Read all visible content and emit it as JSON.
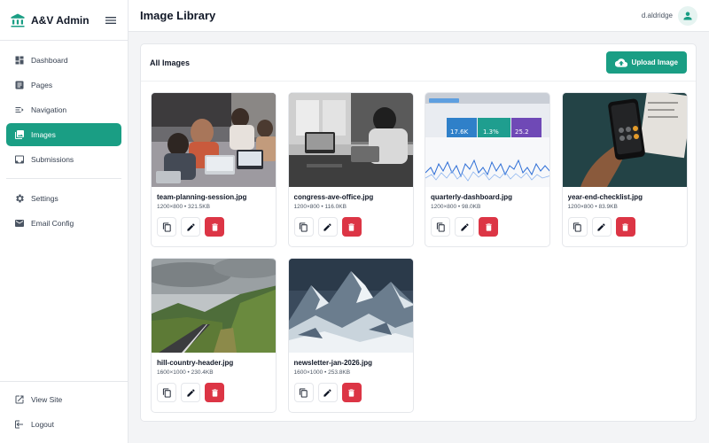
{
  "brand": {
    "name": "A&V Admin"
  },
  "sidebar": {
    "items": [
      {
        "label": "Dashboard",
        "icon": "dashboard-icon"
      },
      {
        "label": "Pages",
        "icon": "document-icon"
      },
      {
        "label": "Navigation",
        "icon": "menu-list-icon"
      },
      {
        "label": "Images",
        "icon": "images-icon",
        "active": true
      },
      {
        "label": "Submissions",
        "icon": "inbox-icon"
      },
      {
        "label": "Settings",
        "icon": "gear-icon"
      },
      {
        "label": "Email Config",
        "icon": "mail-icon"
      }
    ],
    "bottom": [
      {
        "label": "View Site",
        "icon": "external-link-icon"
      },
      {
        "label": "Logout",
        "icon": "logout-icon"
      }
    ]
  },
  "header": {
    "title": "Image Library",
    "username": "d.aldridge"
  },
  "library": {
    "title": "All Images",
    "upload_label": "Upload Image",
    "images": [
      {
        "name": "team-planning-session.jpg",
        "meta": "1200×800 • 321.5KB"
      },
      {
        "name": "congress-ave-office.jpg",
        "meta": "1200×800 • 116.0KB"
      },
      {
        "name": "quarterly-dashboard.jpg",
        "meta": "1200×800 • 98.0KB",
        "dashboard_values": [
          "17.6K",
          "1.3%",
          "25.2"
        ]
      },
      {
        "name": "year-end-checklist.jpg",
        "meta": "1200×800 • 83.9KB"
      },
      {
        "name": "hill-country-header.jpg",
        "meta": "1600×1000 • 230.4KB"
      },
      {
        "name": "newsletter-jan-2026.jpg",
        "meta": "1600×1000 • 253.8KB"
      }
    ]
  },
  "colors": {
    "accent": "#1a9e84",
    "danger": "#dc3545"
  }
}
